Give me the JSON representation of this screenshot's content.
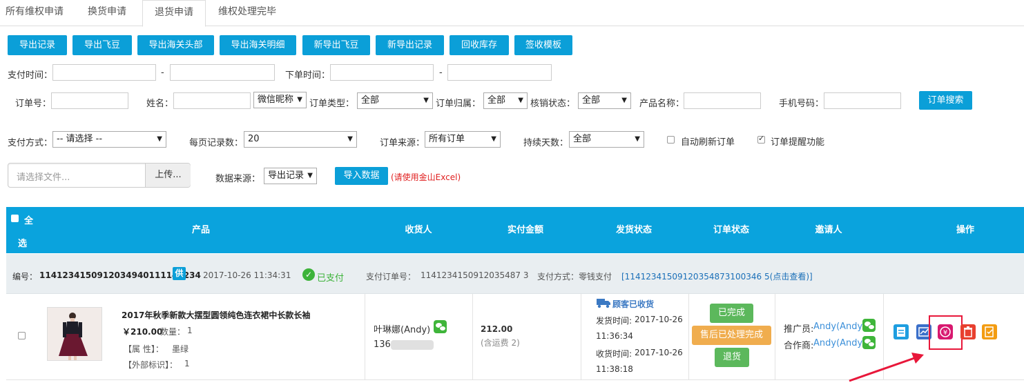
{
  "tabs": [
    {
      "label": "所有维权申请"
    },
    {
      "label": "换货申请"
    },
    {
      "label": "退货申请",
      "active": true
    },
    {
      "label": "维权处理完毕"
    }
  ],
  "toolbar": [
    "导出记录",
    "导出飞豆",
    "导出海关头部",
    "导出海关明细",
    "新导出飞豆",
    "新导出记录",
    "回收库存",
    "签收模板"
  ],
  "filters": {
    "pay_time_label": "支付时间：",
    "order_time_label": "下单时间：",
    "dash": "-",
    "order_no_label": "订单号：",
    "name_label": "姓名：",
    "name_type_select": "微信昵称",
    "order_type_label": "订单类型：",
    "order_type_value": "全部",
    "order_owner_label": "订单归属：",
    "order_owner_value": "全部",
    "verify_status_label": "核销状态：",
    "verify_status_value": "全部",
    "product_name_label": "产品名称：",
    "phone_label": "手机号码：",
    "search_button": "订单搜索",
    "pay_method_label": "支付方式：",
    "pay_method_value": "-- 请选择 --",
    "page_size_label": "每页记录数：",
    "page_size_value": "20",
    "order_source_label": "订单来源：",
    "order_source_value": "所有订单",
    "duration_label": "持续天数：",
    "duration_value": "全部",
    "auto_refresh_label": "自动刷新订单",
    "auto_refresh_checked": false,
    "reminder_label": "订单提醒功能",
    "reminder_checked": true
  },
  "import": {
    "file_placeholder": "请选择文件...",
    "upload_button": "上传...",
    "data_source_label": "数据来源：",
    "data_source_value": "导出记录",
    "import_button": "导入数据",
    "note": "(请使用金山Excel)"
  },
  "table_header": {
    "select_all": "全",
    "select_all_2": "选",
    "product": "产品",
    "receiver": "收货人",
    "paid": "实付金额",
    "ship_status": "发货状态",
    "order_status": "订单状态",
    "inviter": "邀请人",
    "actions": "操作"
  },
  "order": {
    "number_label": "编号：",
    "number": "1141234150912034940111141234",
    "supply_badge": "供",
    "time": "2017-10-26 11:34:31",
    "paid_status": "已支付",
    "pay_order_label": "支付订单号：",
    "pay_order_no": "1141234150912035487 3",
    "pay_method_text": "支付方式：零钱支付",
    "pay_link": "[11412341509120354873100346 5(点击查看)]",
    "product_title": "2017年秋季新款大摆型圆领纯色连衣裙中长款长袖",
    "price": "￥210.00",
    "qty_label": "数量：",
    "qty": "1",
    "attr_label": "【属 性】：",
    "attr_value": "墨绿",
    "ext_label": "【外部标识】：",
    "ext_value": "1",
    "receiver_name": "叶琳娜(Andy)",
    "receiver_phone": "136",
    "amount": "212.00",
    "shipping_note": "(含运费 2)",
    "ship_status": "顾客已收货",
    "ship_time_label": "发货时间:",
    "ship_date": "2017-10-26",
    "ship_clock": "11:36:34",
    "recv_time_label": "收货时间:",
    "recv_date": "2017-10-26",
    "recv_clock": "11:38:18",
    "status_done": "已完成",
    "status_after_sale": "售后已处理完成",
    "status_refund": "退货",
    "promoter_label": "推广员:",
    "promoter": "Andy(Andy)",
    "partner_label": "合作商:",
    "partner": "Andy(Andy)"
  },
  "colors": {
    "accent": "#0aa3dd",
    "green": "#5cb85c",
    "orange": "#f0ad4e",
    "highlight": "#e8173a"
  }
}
